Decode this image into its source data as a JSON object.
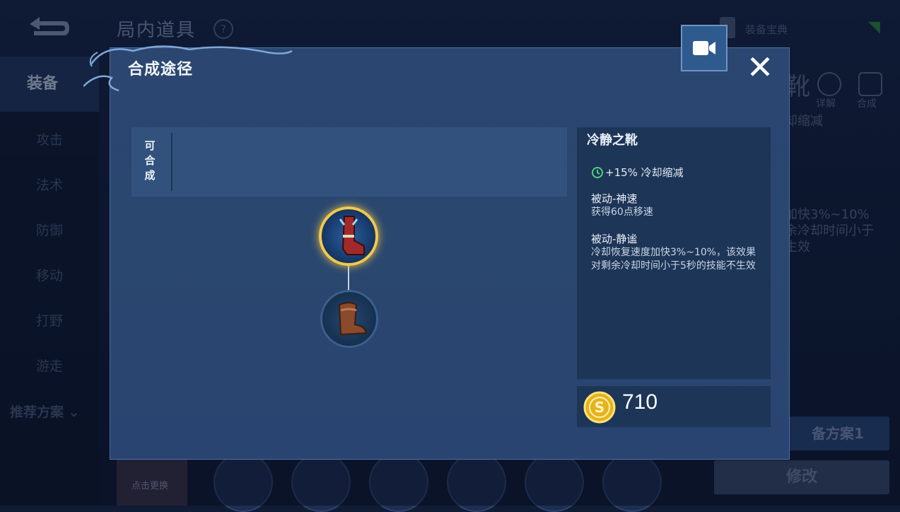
{
  "background": {
    "title": "局内道具",
    "help_glyph": "?",
    "codex_label": "装备宝典",
    "sidebar": [
      {
        "label": "装备",
        "active": true
      },
      {
        "label": "攻击",
        "active": false
      },
      {
        "label": "法术",
        "active": false
      },
      {
        "label": "防御",
        "active": false
      },
      {
        "label": "移动",
        "active": false
      },
      {
        "label": "打野",
        "active": false
      },
      {
        "label": "游走",
        "active": false
      }
    ],
    "recommend_label": "推荐方案",
    "right_big_char": "靴",
    "detail_label": "详解",
    "compose_label": "合成",
    "right_text_line1": "却缩减",
    "right_text_line2": "加快3%~10%",
    "right_text_line3": "余冷却时间小于",
    "right_text_line4": "生效",
    "plan_button": "备方案1",
    "modify_button": "修改",
    "hero_label": "点击更换"
  },
  "modal": {
    "title": "合成途径",
    "close_glyph": "✕",
    "craftable_label": "可合成",
    "item": {
      "name": "冷静之靴",
      "stat": "+15% 冷却缩减",
      "passives": [
        {
          "title": "被动-神速",
          "desc": "获得60点移速"
        },
        {
          "title": "被动-静谧",
          "desc": "冷却恢复速度加快3%~10%，该效果对剩余冷却时间小于5秒的技能不生效"
        }
      ],
      "price": "710"
    },
    "tree": {
      "main_icon": "calm-boots-icon",
      "sub_icon": "basic-boots-icon"
    },
    "colors": {
      "gold_ring": "#f3c94a",
      "panel": "#1d3556",
      "modal_bg": "#2b4670"
    }
  }
}
